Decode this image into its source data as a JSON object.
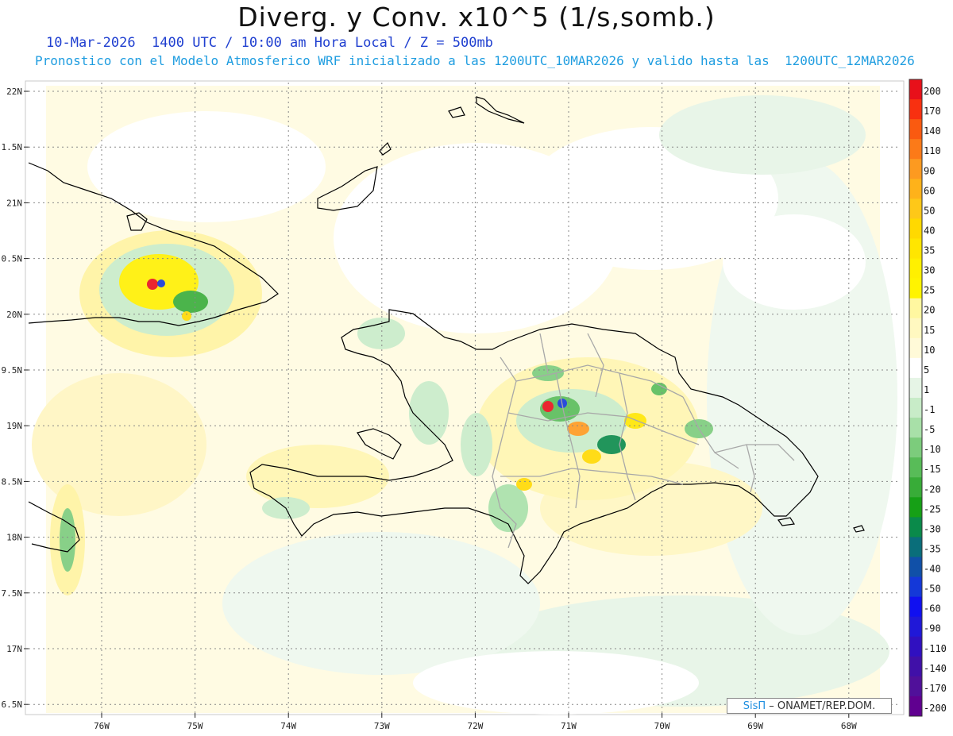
{
  "title": "Diverg. y Conv. x10^5 (1/s,somb.)",
  "subtitle_1": "10-Mar-2026  1400 UTC / 10:00 am Hora Local / Z = 500mb",
  "subtitle_2": "Pronostico con el Modelo Atmosferico WRF inicializado a las 1200UTC_10MAR2026 y valido hasta las  1200UTC_12MAR2026",
  "lat_labels": [
    "22N",
    "1.5N",
    "21N",
    "0.5N",
    "20N",
    "9.5N",
    "19N",
    "8.5N",
    "18N",
    "7.5N",
    "17N",
    "6.5N"
  ],
  "lon_labels": [
    "76W",
    "75W",
    "74W",
    "73W",
    "72W",
    "71W",
    "70W",
    "69W",
    "68W"
  ],
  "colorbar": {
    "labels": [
      "200",
      "170",
      "140",
      "110",
      "90",
      "60",
      "50",
      "40",
      "35",
      "30",
      "25",
      "20",
      "15",
      "10",
      "5",
      "1",
      "-1",
      "-5",
      "-10",
      "-15",
      "-20",
      "-25",
      "-30",
      "-35",
      "-40",
      "-50",
      "-60",
      "-90",
      "-110",
      "-140",
      "-170",
      "-200"
    ],
    "colors": [
      "#e8101a",
      "#f83010",
      "#fa5a10",
      "#fc7a18",
      "#fd9a20",
      "#feb21a",
      "#fec818",
      "#ffd900",
      "#ffe600",
      "#fff000",
      "#fff400",
      "#fff7a0",
      "#fff8c0",
      "#fffad8",
      "#ffffff",
      "#e6f5e6",
      "#c8ecc8",
      "#a8e0a8",
      "#7ccc7c",
      "#58bc58",
      "#38ac38",
      "#16a016",
      "#0a8a4a",
      "#0a6e7a",
      "#1050a8",
      "#1438d8",
      "#1010f0",
      "#2018d8",
      "#3010c0",
      "#4010a8",
      "#50109a",
      "#600090"
    ]
  },
  "credit": {
    "brand": "SisΠ",
    "rest": "– ONAMET/REP.DOM."
  }
}
